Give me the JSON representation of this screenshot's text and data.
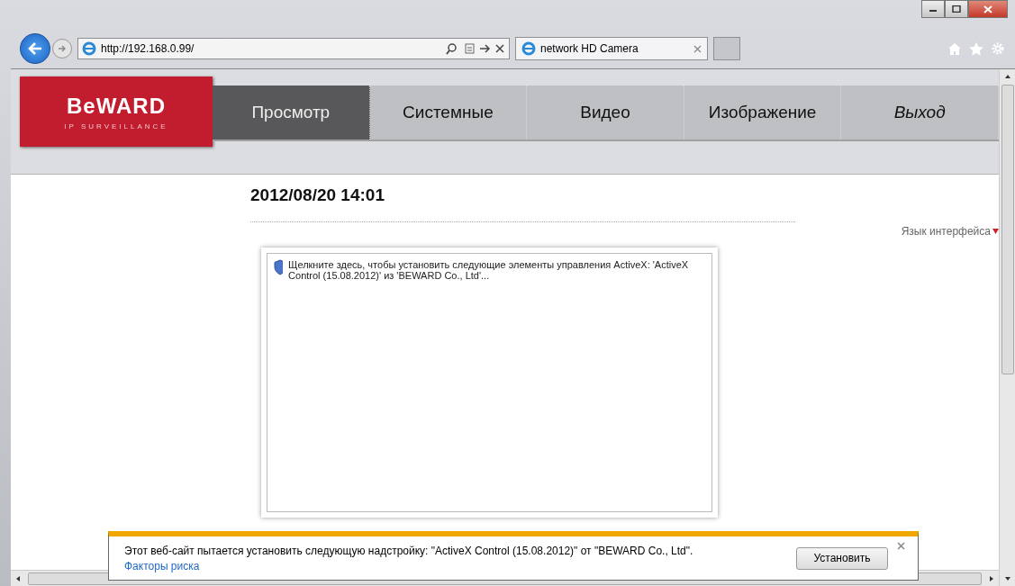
{
  "browser": {
    "address": "http://192.168.0.99/",
    "tabs": [
      {
        "label": "network HD Camera",
        "selected": true
      }
    ]
  },
  "logo": {
    "brand": "BeWARD",
    "tagline": "IP SURVEILLANCE"
  },
  "nav": [
    {
      "label": "Просмотр",
      "selected": true,
      "kind": "page"
    },
    {
      "label": "Системные",
      "selected": false,
      "kind": "page"
    },
    {
      "label": "Видео",
      "selected": false,
      "kind": "page"
    },
    {
      "label": "Изображение",
      "selected": false,
      "kind": "page"
    },
    {
      "label": "Выход",
      "selected": false,
      "kind": "exit"
    }
  ],
  "datetime": "2012/08/20 14:01",
  "language_link": "Язык интерфейса",
  "activex_prompt": "Щелкните здесь, чтобы установить следующие элементы управления ActiveX: 'ActiveX Control (15.08.2012)' из 'BEWARD Co., Ltd'...",
  "notification": {
    "message": "Этот веб-сайт пытается установить следующую надстройку: \"ActiveX Control (15.08.2012)\" от \"BEWARD Co., Ltd\".",
    "link": "Факторы риска",
    "button": "Установить"
  }
}
